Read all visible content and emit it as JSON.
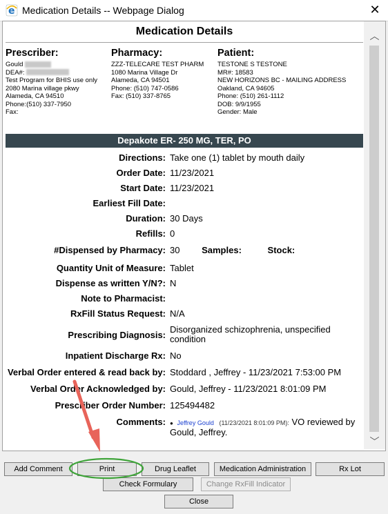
{
  "window": {
    "title": "Medication Details -- Webpage Dialog",
    "close_glyph": "✕"
  },
  "page_title": "Medication Details",
  "prescriber": {
    "heading": "Prescriber:",
    "name": "Gould",
    "dea_label": "DEA#:",
    "program": "Test Program for BHIS use only",
    "address1": "2080 Marina village pkwy",
    "address2": "Alameda, CA 94510",
    "phone": "Phone:(510) 337-7950",
    "fax": "Fax:"
  },
  "pharmacy": {
    "heading": "Pharmacy:",
    "name": "ZZZ-TELECARE TEST PHARM",
    "address1": "1080 Marina Village Dr",
    "address2": "Alameda, CA 94501",
    "phone": "Phone: (510) 747-0586",
    "fax": "Fax: (510) 337-8765"
  },
  "patient": {
    "heading": "Patient:",
    "name": "TESTONE S TESTONE",
    "mr": "MR#: 18583",
    "address1": "NEW HORIZONS BC - MAILING ADDRESS",
    "address2": "Oakland, CA 94605",
    "phone": "Phone: (510) 261-1112",
    "dob": "DOB: 9/9/1955",
    "gender": "Gender: Male"
  },
  "drug": "Depakote ER- 250 MG, TER, PO",
  "fields": {
    "directions": {
      "label": "Directions:",
      "value": "Take one (1) tablet by mouth daily"
    },
    "order_date": {
      "label": "Order Date:",
      "value": "11/23/2021"
    },
    "start_date": {
      "label": "Start Date:",
      "value": "11/23/2021"
    },
    "earliest_fill": {
      "label": "Earliest Fill Date:",
      "value": ""
    },
    "duration": {
      "label": "Duration:",
      "value": "30 Days"
    },
    "refills": {
      "label": "Refills:",
      "value": "0"
    },
    "dispensed": {
      "label": "#Dispensed by Pharmacy:",
      "value": "30",
      "samples_label": "Samples:",
      "stock_label": "Stock:"
    },
    "qty_unit": {
      "label": "Quantity Unit of Measure:",
      "value": "Tablet"
    },
    "daw": {
      "label": "Dispense as written Y/N?:",
      "value": "N"
    },
    "note": {
      "label": "Note to Pharmacist:",
      "value": ""
    },
    "rxfill_status": {
      "label": "RxFill Status Request:",
      "value": "N/A"
    },
    "diagnosis": {
      "label": "Prescribing Diagnosis:",
      "value": "Disorganized schizophrenia, unspecified condition"
    },
    "inpatient_discharge": {
      "label": "Inpatient Discharge Rx:",
      "value": "No"
    },
    "verbal_entered": {
      "label": "Verbal Order entered & read back by:",
      "value": "Stoddard , Jeffrey - 11/23/2021 7:53:00 PM"
    },
    "verbal_ack": {
      "label": "Verbal Order Acknowledged by:",
      "value": "Gould, Jeffrey - 11/23/2021 8:01:09 PM"
    },
    "order_number": {
      "label": "Prescriber Order Number:",
      "value": "125494482"
    },
    "comments": {
      "label": "Comments:",
      "author": "Jeffrey Gould",
      "date": "(11/23/2021 8:01:09 PM):",
      "text": "VO reviewed by Gould, Jeffrey."
    }
  },
  "buttons": {
    "add_comment": "Add Comment",
    "print": "Print",
    "drug_leaflet": "Drug Leaflet",
    "med_admin": "Medication Administration",
    "rx_lot": "Rx Lot",
    "check_formulary": "Check Formulary",
    "change_rxfill": "Change RxFill Indicator",
    "close": "Close"
  },
  "colors": {
    "banner": "#37474f",
    "annotation_arrow": "#e8645a",
    "annotation_ring": "#3fa43a"
  }
}
